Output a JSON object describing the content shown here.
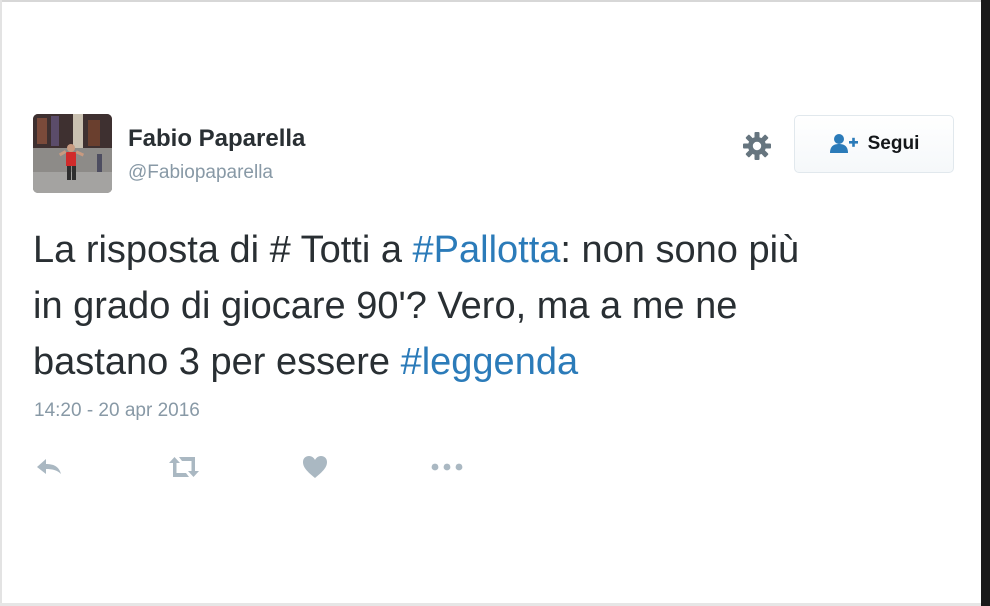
{
  "tweet": {
    "user": {
      "name": "Fabio Paparella",
      "handle": "@Fabiopaparella"
    },
    "follow_label": "Segui",
    "text_lines": [
      [
        {
          "text": "La risposta di # Totti a ",
          "hashtag": false
        },
        {
          "text": "#Pallotta",
          "hashtag": true
        },
        {
          "text": ": non sono più",
          "hashtag": false
        }
      ],
      [
        {
          "text": "in grado di giocare 90'? Vero, ma a me ne",
          "hashtag": false
        }
      ],
      [
        {
          "text": "bastano 3 per essere ",
          "hashtag": false
        },
        {
          "text": "#leggenda",
          "hashtag": true
        }
      ]
    ],
    "timestamp": "14:20 - 20 apr 2016",
    "actions": [
      "reply-icon",
      "retweet-icon",
      "like-icon",
      "more-icon"
    ]
  },
  "colors": {
    "hashtag": "#2b7bb9",
    "icon_gray": "#aab8c2",
    "follow_icon": "#2b7bb9",
    "text": "#292f33",
    "muted": "#8899a6"
  }
}
